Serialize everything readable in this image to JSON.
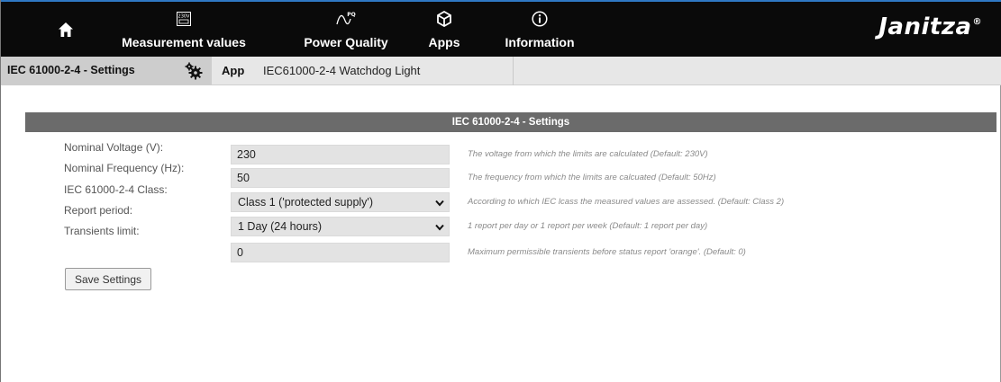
{
  "nav": {
    "home_icon": "home-icon",
    "items": [
      {
        "label": "Measurement values",
        "icon": "measurement-values-icon",
        "icon_text": "230V"
      },
      {
        "label": "Power Quality",
        "icon": "power-quality-icon",
        "icon_text": "PQ"
      },
      {
        "label": "Apps",
        "icon": "apps-icon"
      },
      {
        "label": "Information",
        "icon": "information-icon"
      }
    ],
    "brand": "Janitza",
    "brand_mark": "®"
  },
  "subbar": {
    "settings_label": "IEC 61000-2-4 - Settings",
    "gear_icon": "gear-icon",
    "app_label": "App",
    "app_name": "IEC61000-2-4 Watchdog Light"
  },
  "panel": {
    "title": "IEC 61000-2-4 - Settings",
    "rows": [
      {
        "label": "Nominal Voltage (V):",
        "value": "230",
        "hint": "The voltage from which the limits are calculated (Default: 230V)"
      },
      {
        "label": "Nominal Frequency (Hz):",
        "value": "50",
        "hint": "The frequency from which the limits are calcuated (Default: 50Hz)"
      },
      {
        "label": "IEC 61000-2-4 Class:",
        "value": "Class 1 ('protected supply')",
        "hint": "According to which IEC lcass the measured values are assessed. (Default: Class 2)"
      },
      {
        "label": "Report period:",
        "value": "1 Day (24 hours)",
        "hint": "1 report per day or 1 report per week (Default: 1 report per day)"
      },
      {
        "label": "Transients limit:",
        "value": "0",
        "hint": "Maximum permissible transients before status report 'orange'. (Default: 0)"
      }
    ],
    "save_label": "Save Settings"
  },
  "colors": {
    "topbar": "#0a0a0a",
    "accent": "#2f78c4",
    "panel_header": "#6b6b6b",
    "field_bg": "#e3e3e3"
  }
}
